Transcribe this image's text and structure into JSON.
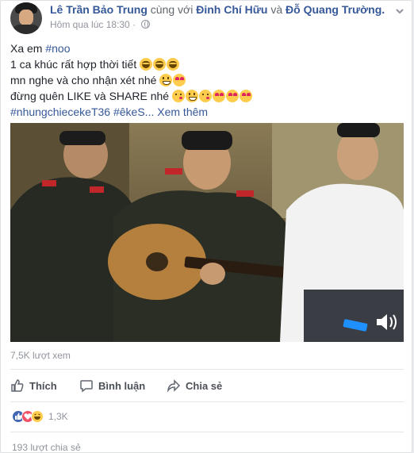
{
  "post": {
    "author": "Lê Trần Bảo Trung",
    "with_text": "cùng với",
    "tagged_1": "Đinh Chí Hữu",
    "and_text": "và",
    "tagged_2": "Đỗ Quang Trường.",
    "timestamp": "Hôm qua lúc 18:30",
    "separator": "·",
    "privacy_icon": "globe-icon",
    "menu_icon": "chevron-down-icon"
  },
  "message": {
    "line1_prefix": "Xa em",
    "line1_tag": "#noo",
    "line2": "1 ca khúc rất hợp thời tiết",
    "line3": "mn nghe và cho nhận xét nhé",
    "line4": "đừng quên LIKE và SHARE nhé",
    "hashtags": "#nhungchiecekeT36 #êkeS...",
    "see_more": "Xem thêm"
  },
  "video": {
    "volume_icon": "speaker-icon"
  },
  "stats": {
    "views": "7,5K lượt xem",
    "reaction_count": "1,3K",
    "shares": "193 lượt chia sẻ"
  },
  "actions": {
    "like": "Thích",
    "comment": "Bình luận",
    "share": "Chia sẻ"
  },
  "colors": {
    "link": "#365899",
    "meta": "#90949c",
    "like_blue": "#4267b2",
    "love_red": "#f25268",
    "haha_yellow": "#ffcc4d"
  }
}
